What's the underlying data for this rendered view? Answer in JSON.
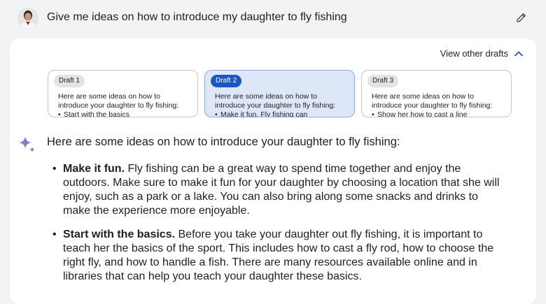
{
  "prompt": {
    "text": "Give me ideas on how to introduce my daughter to fly fishing",
    "avatar_icon": "user-avatar",
    "edit_icon": "pencil-icon"
  },
  "drafts_header": {
    "label": "View other drafts",
    "icon": "chevron-up-icon"
  },
  "drafts": [
    {
      "chip": "Draft 1",
      "preview": "Here are some ideas on how to introduce your daughter to fly fishing:",
      "bullet": "Start with the basics",
      "selected": false
    },
    {
      "chip": "Draft 2",
      "preview": "Here are some ideas on how to introduce your daughter to fly fishing:",
      "bullet": "Make it fun. Fly fishing can",
      "selected": true
    },
    {
      "chip": "Draft 3",
      "preview": "Here are some ideas on how to introduce your daughter to fly fishing:",
      "bullet": "Show her how to cast a line",
      "selected": false
    }
  ],
  "response": {
    "icon": "sparkle-icon",
    "intro": "Here are some ideas on how to introduce your daughter to fly fishing:",
    "items": [
      {
        "title": "Make it fun.",
        "body": " Fly fishing can be a great way to spend time together and enjoy the outdoors. Make sure to make it fun for your daughter by choosing a location that she will enjoy, such as a park or a lake. You can also bring along some snacks and drinks to make the experience more enjoyable."
      },
      {
        "title": "Start with the basics.",
        "body": " Before you take your daughter out fly fishing, it is important to teach her the basics of the sport. This includes how to cast a fly rod, how to choose the right fly, and how to handle a fish. There are many resources available online and in libraries that can help you teach your daughter these basics."
      }
    ]
  },
  "colors": {
    "page_bg": "#f1f3f4",
    "card_bg": "#ffffff",
    "selected_draft_bg": "#dde7f7",
    "selected_chip_bg": "#1a56c4"
  }
}
